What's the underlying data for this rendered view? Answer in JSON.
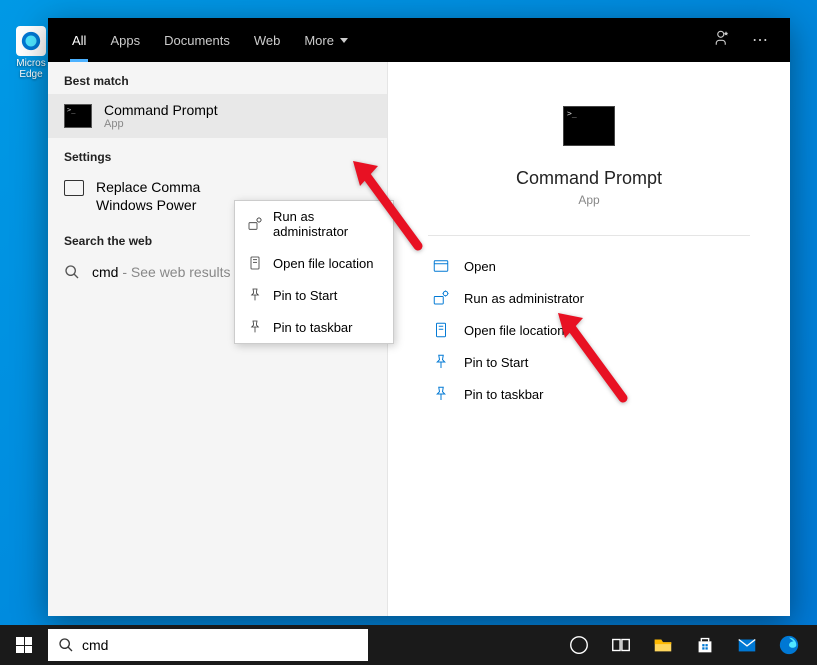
{
  "desktop": {
    "icon_label": "Micros\nEdge"
  },
  "tabs": {
    "all": "All",
    "apps": "Apps",
    "documents": "Documents",
    "web": "Web",
    "more": "More"
  },
  "sections": {
    "best_match": "Best match",
    "settings": "Settings",
    "search_web": "Search the web"
  },
  "best_match": {
    "title": "Command Prompt",
    "sub": "App"
  },
  "settings_item": "Replace Comma\nWindows Power",
  "web_item": {
    "query": "cmd",
    "hint": " - See web results"
  },
  "context_menu": {
    "run_admin": "Run as administrator",
    "open_loc": "Open file location",
    "pin_start": "Pin to Start",
    "pin_taskbar": "Pin to taskbar"
  },
  "preview": {
    "title": "Command Prompt",
    "sub": "App"
  },
  "actions": {
    "open": "Open",
    "run_admin": "Run as administrator",
    "open_loc": "Open file location",
    "pin_start": "Pin to Start",
    "pin_taskbar": "Pin to taskbar"
  },
  "search_input": {
    "value": "cmd"
  }
}
